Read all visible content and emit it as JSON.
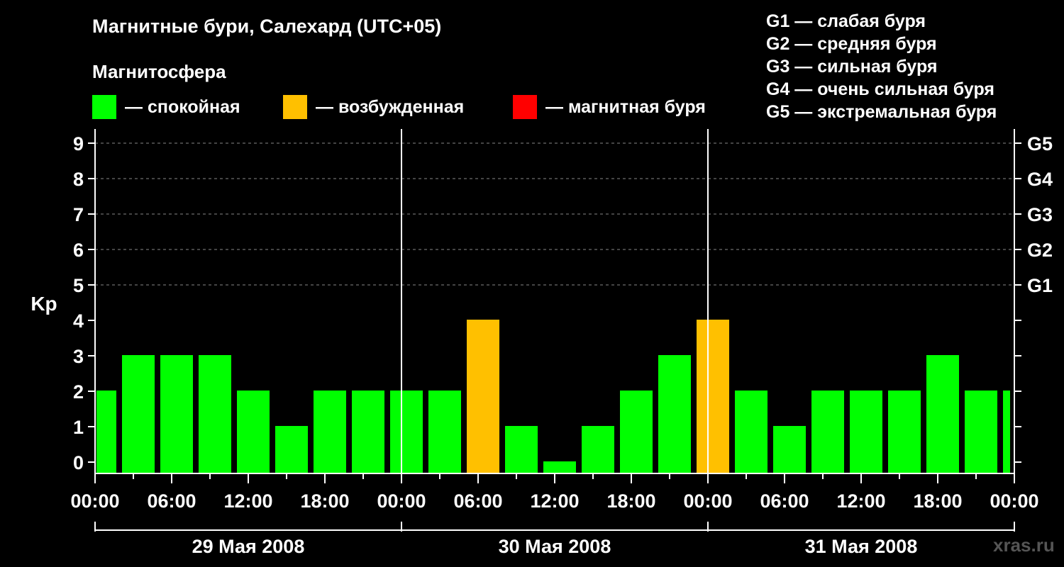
{
  "title": "Магнитные бури, Салехард (UTC+05)",
  "subtitle": "Магнитосфера",
  "legend": [
    {
      "label": "— спокойная",
      "color": "#00ff00"
    },
    {
      "label": "— возбужденная",
      "color": "#ffc000"
    },
    {
      "label": "— магнитная буря",
      "color": "#ff0000"
    }
  ],
  "g_scale": [
    "G1 — слабая буря",
    "G2 — средняя буря",
    "G3 — сильная буря",
    "G4 — очень сильная буря",
    "G5 — экстремальная буря"
  ],
  "watermark": "xras.ru",
  "chart_data": {
    "type": "bar",
    "ylabel": "Kp",
    "ylim": [
      0,
      9
    ],
    "yticks": [
      0,
      1,
      2,
      3,
      4,
      5,
      6,
      7,
      8,
      9
    ],
    "right_axis_labels": [
      {
        "value": 5,
        "label": "G1"
      },
      {
        "value": 6,
        "label": "G2"
      },
      {
        "value": 7,
        "label": "G3"
      },
      {
        "value": 8,
        "label": "G4"
      },
      {
        "value": 9,
        "label": "G5"
      }
    ],
    "x_tick_labels": [
      "00:00",
      "06:00",
      "12:00",
      "18:00",
      "00:00",
      "06:00",
      "12:00",
      "18:00",
      "00:00",
      "06:00",
      "12:00",
      "18:00",
      "00:00"
    ],
    "days": [
      "29 Мая 2008",
      "30 Мая 2008",
      "31 Мая 2008"
    ],
    "bar_start_hours": [
      0,
      2,
      5,
      8,
      11,
      14,
      17,
      20,
      23,
      26,
      29,
      32,
      35,
      38,
      41,
      44,
      47,
      50,
      53,
      56,
      59,
      62,
      65,
      68,
      71
    ],
    "bar_end_hours": [
      2,
      5,
      8,
      11,
      14,
      17,
      20,
      23,
      26,
      29,
      32,
      35,
      38,
      41,
      44,
      47,
      50,
      53,
      56,
      59,
      62,
      65,
      68,
      71,
      72
    ],
    "values": [
      2,
      3,
      3,
      3,
      2,
      1,
      2,
      2,
      2,
      2,
      4,
      1,
      0,
      1,
      2,
      3,
      4,
      2,
      1,
      2,
      2,
      2,
      3,
      2,
      2
    ],
    "colors": {
      "quiet": "#00ff00",
      "active": "#ffc000",
      "storm": "#ff0000"
    },
    "grid": true
  }
}
